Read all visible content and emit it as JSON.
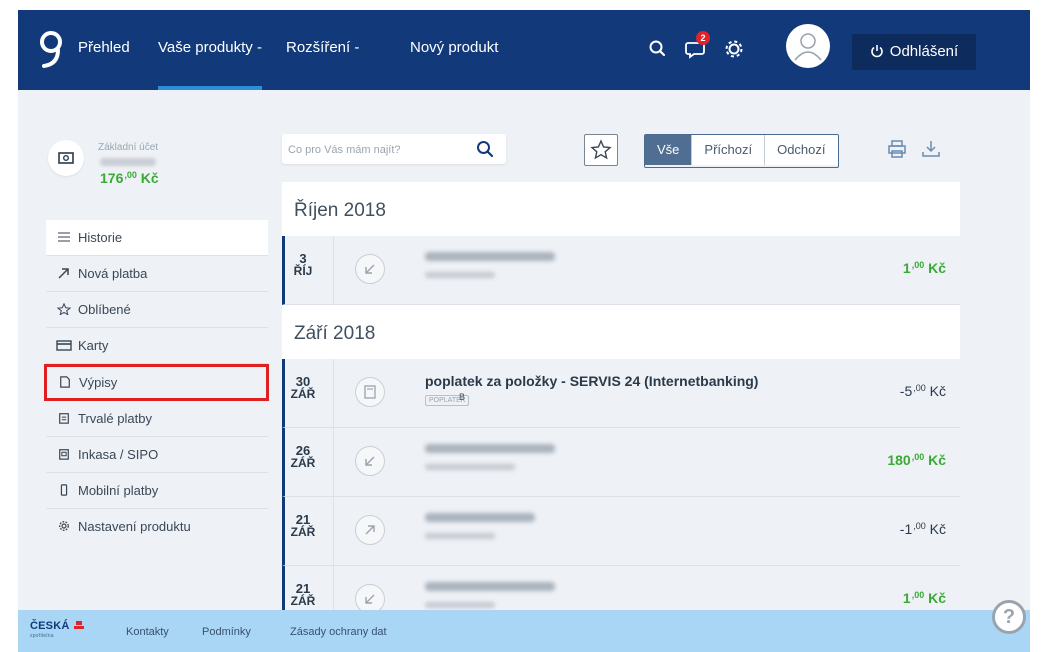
{
  "nav": {
    "items": [
      {
        "label": "Přehled"
      },
      {
        "label": "Vaše produkty -"
      },
      {
        "label": "Rozšíření -"
      },
      {
        "label": "Nový produkt"
      }
    ],
    "notification_count": "2",
    "logout_label": "Odhlášení",
    "icons": [
      "search-icon",
      "notification-icon",
      "settings-icon",
      "avatar",
      "power-icon"
    ]
  },
  "account": {
    "label": "Základní účet",
    "amount_main": "176",
    "amount_decimal": ",00",
    "currency": "Kč",
    "amount_color": "#3aaa35"
  },
  "sidebar": {
    "items": [
      {
        "label": "Historie",
        "icon": "list-icon"
      },
      {
        "label": "Nová platba",
        "icon": "arrow-up-right-icon"
      },
      {
        "label": "Oblíbené",
        "icon": "star-icon"
      },
      {
        "label": "Karty",
        "icon": "card-icon"
      },
      {
        "label": "Výpisy",
        "icon": "document-icon"
      },
      {
        "label": "Trvalé platby",
        "icon": "clipboard-icon"
      },
      {
        "label": "Inkasa / SIPO",
        "icon": "inkaso-icon"
      },
      {
        "label": "Mobilní platby",
        "icon": "mobile-icon"
      },
      {
        "label": "Nastavení produktu",
        "icon": "gear-icon"
      }
    ]
  },
  "search": {
    "placeholder": "Co pro Vás mám najít?"
  },
  "filter": {
    "all": "Vše",
    "incoming": "Příchozí",
    "outgoing": "Odchozí"
  },
  "months": [
    {
      "title": "Říjen 2018",
      "transactions": [
        {
          "day": "3",
          "month": "ŘÍJ",
          "direction": "incoming",
          "amount_main": "1",
          "amount_decimal": ",00",
          "currency": "Kč"
        }
      ]
    },
    {
      "title": "Září 2018",
      "transactions": [
        {
          "day": "30",
          "month": "ZÁŘ",
          "direction": "fee",
          "title": "poplatek za položky - SERVIS 24 (Internetbanking)",
          "tag": "POPLATEK",
          "tag_sup": "B",
          "amount_main": "-5",
          "amount_decimal": ",00",
          "currency": "Kč"
        },
        {
          "day": "26",
          "month": "ZÁŘ",
          "direction": "incoming",
          "amount_main": "180",
          "amount_decimal": ",00",
          "currency": "Kč"
        },
        {
          "day": "21",
          "month": "ZÁŘ",
          "direction": "outgoing",
          "amount_main": "-1",
          "amount_decimal": ",00",
          "currency": "Kč"
        },
        {
          "day": "21",
          "month": "ZÁŘ",
          "direction": "incoming",
          "amount_main": "1",
          "amount_decimal": ",00",
          "currency": "Kč"
        }
      ]
    }
  ],
  "footer": {
    "brand": "ČESKÁ",
    "brand_sub": "spořitelna",
    "links": [
      {
        "label": "Kontakty"
      },
      {
        "label": "Podmínky"
      },
      {
        "label": "Zásady ochrany dat"
      }
    ]
  },
  "colors": {
    "nav_bg": "#123a7a",
    "positive": "#3aaa35",
    "highlight_box": "#e02020",
    "footer_bg": "#a8d6f4"
  }
}
